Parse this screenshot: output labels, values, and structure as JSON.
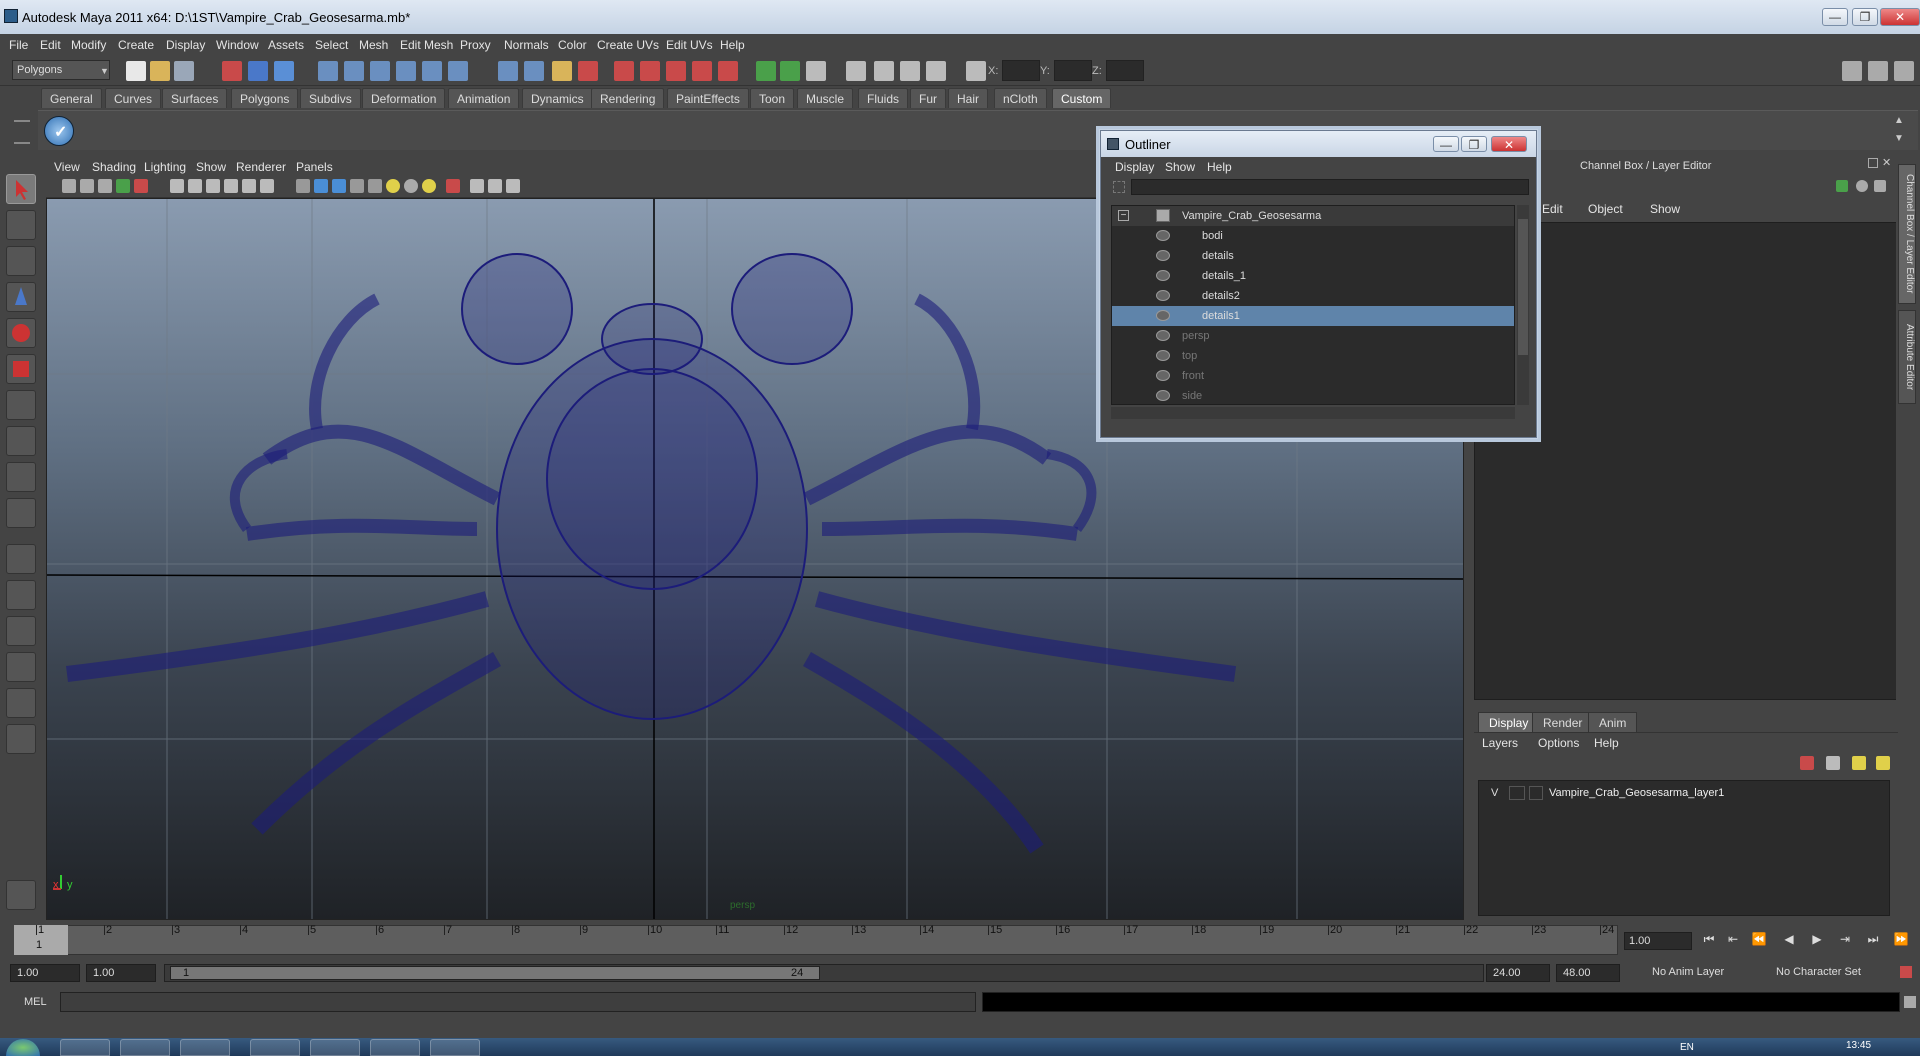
{
  "window": {
    "title": "Autodesk Maya 2011 x64: D:\\1ST\\Vampire_Crab_Geosesarma.mb*",
    "controls": [
      "—",
      "❐",
      "✕"
    ]
  },
  "menubar": [
    "File",
    "Edit",
    "Modify",
    "Create",
    "Display",
    "Window",
    "Assets",
    "Select",
    "Mesh",
    "Edit Mesh",
    "Proxy",
    "Normals",
    "Color",
    "Create UVs",
    "Edit UVs",
    "Help"
  ],
  "statusline": {
    "mode": "Polygons",
    "x_label": "X:",
    "y_label": "Y:",
    "z_label": "Z:"
  },
  "shelf_tabs": [
    "General",
    "Curves",
    "Surfaces",
    "Polygons",
    "Subdivs",
    "Deformation",
    "Animation",
    "Dynamics",
    "Rendering",
    "PaintEffects",
    "Toon",
    "Muscle",
    "Fluids",
    "Fur",
    "Hair",
    "nCloth",
    "Custom"
  ],
  "shelf_active": "Custom",
  "viewport": {
    "menus": [
      "View",
      "Shading",
      "Lighting",
      "Show",
      "Renderer",
      "Panels"
    ],
    "camera_label": "persp",
    "axis_x": "x",
    "axis_y": "y"
  },
  "outliner": {
    "title": "Outliner",
    "menus": [
      "Display",
      "Show",
      "Help"
    ],
    "items": [
      {
        "label": "Vampire_Crab_Geosesarma",
        "type": "group"
      },
      {
        "label": "bodi",
        "type": "mesh"
      },
      {
        "label": "details",
        "type": "mesh"
      },
      {
        "label": "details_1",
        "type": "mesh"
      },
      {
        "label": "details2",
        "type": "mesh"
      },
      {
        "label": "details1",
        "type": "mesh",
        "selected": true
      },
      {
        "label": "persp",
        "type": "camera"
      },
      {
        "label": "top",
        "type": "camera"
      },
      {
        "label": "front",
        "type": "camera"
      },
      {
        "label": "side",
        "type": "camera"
      }
    ]
  },
  "channel_box": {
    "title": "Channel Box / Layer Editor",
    "menus": [
      "Edit",
      "Object",
      "Show"
    ]
  },
  "side_tabs": [
    "Channel Box / Layer Editor",
    "Attribute Editor"
  ],
  "layer_editor": {
    "tabs": [
      "Display",
      "Render",
      "Anim"
    ],
    "active_tab": "Display",
    "menus": [
      "Layers",
      "Options",
      "Help"
    ],
    "layer": {
      "visible": "V",
      "name": "Vampire_Crab_Geosesarma_layer1"
    }
  },
  "timeslider": {
    "ticks": [
      "1",
      "2",
      "3",
      "4",
      "5",
      "6",
      "7",
      "8",
      "9",
      "10",
      "11",
      "12",
      "13",
      "14",
      "15",
      "16",
      "17",
      "18",
      "19",
      "20",
      "21",
      "22",
      "23",
      "24"
    ],
    "playhead_label": "1",
    "current_frame": "1.00"
  },
  "range": {
    "start": "1.00",
    "anim_start": "1.00",
    "range_start": "1",
    "range_end": "24",
    "anim_end": "24.00",
    "end": "48.00",
    "anim_layer": "No Anim Layer",
    "character_set": "No Character Set"
  },
  "commandline": {
    "label": "MEL"
  },
  "taskbar": {
    "lang": "EN",
    "time": "13:45"
  },
  "colors": {
    "wireframe": "#1c1c7a",
    "selection": "#5f84aa",
    "accent": "#6b8fb5"
  }
}
